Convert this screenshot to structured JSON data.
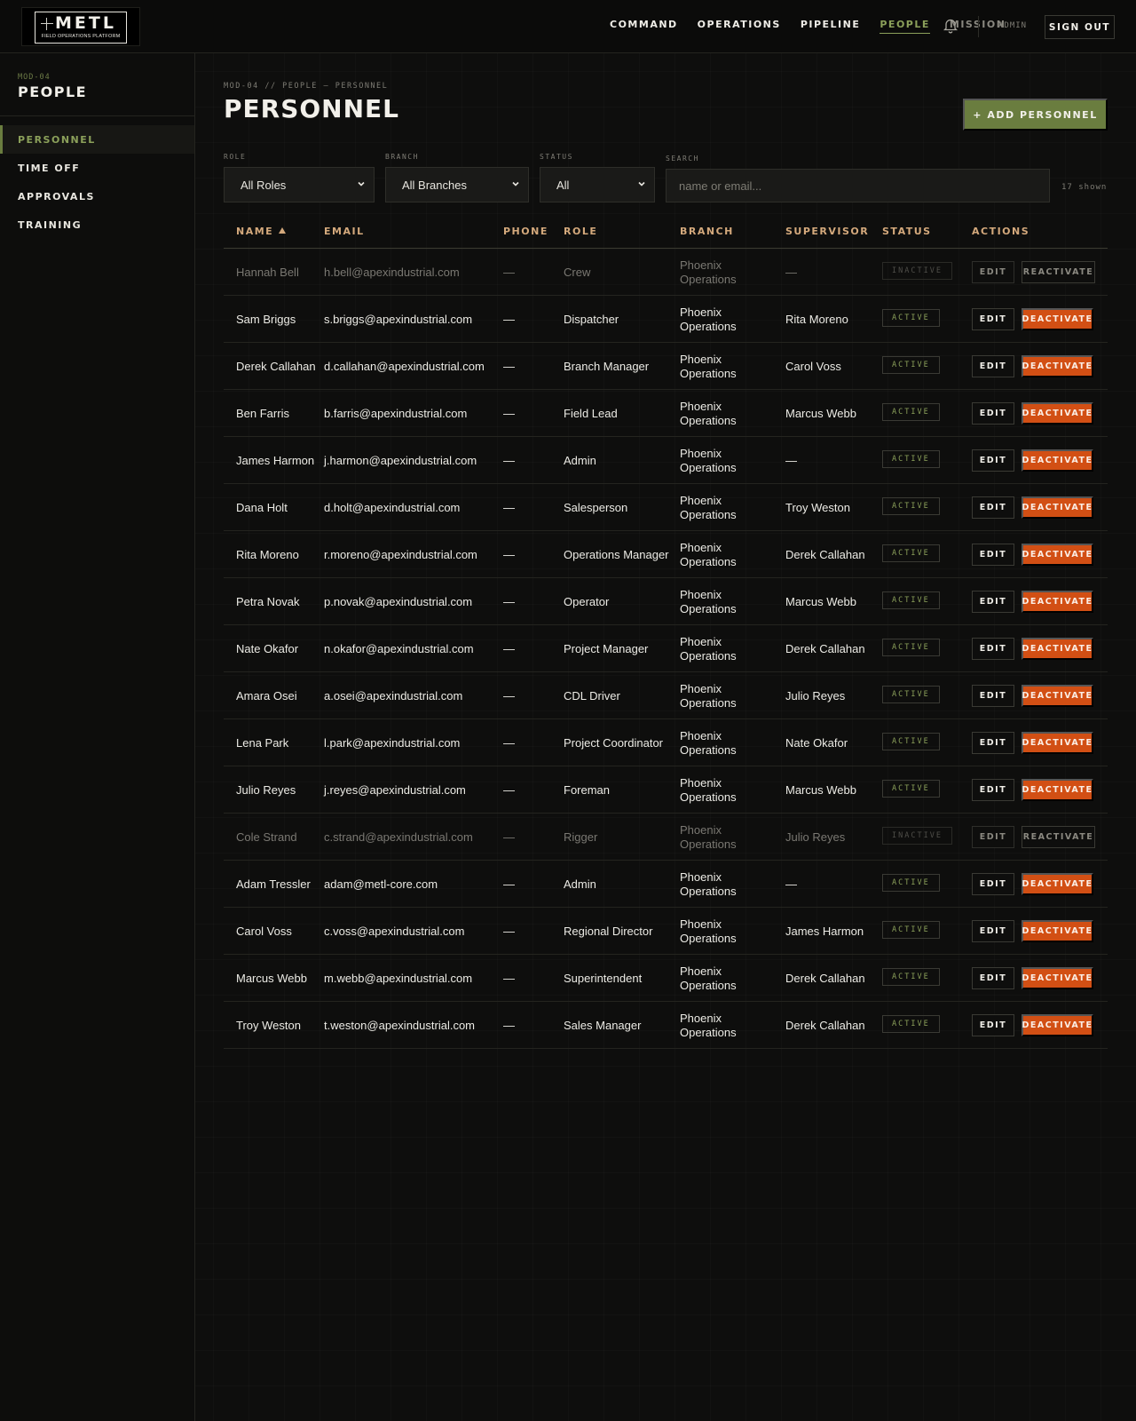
{
  "app": {
    "logo_text": "METL",
    "logo_subtitle": "FIELD OPERATIONS PLATFORM"
  },
  "nav": {
    "items": [
      {
        "label": "COMMAND",
        "state": "normal"
      },
      {
        "label": "OPERATIONS",
        "state": "normal"
      },
      {
        "label": "PIPELINE",
        "state": "normal"
      },
      {
        "label": "PEOPLE",
        "state": "active"
      },
      {
        "label": "MISSION",
        "state": "muted"
      }
    ],
    "bell_icon": "bell-icon",
    "user_label": "ADMIN",
    "sign_out_label": "SIGN OUT"
  },
  "sidebar": {
    "module_code": "MOD-04",
    "title": "PEOPLE",
    "items": [
      {
        "label": "PERSONNEL",
        "active": true
      },
      {
        "label": "TIME OFF",
        "active": false
      },
      {
        "label": "APPROVALS",
        "active": false
      },
      {
        "label": "TRAINING",
        "active": false
      }
    ]
  },
  "page": {
    "breadcrumb": "MOD-04 // PEOPLE — PERSONNEL",
    "title": "PERSONNEL",
    "add_button_label": "+ ADD PERSONNEL"
  },
  "filters": {
    "role": {
      "label": "ROLE",
      "value": "All Roles"
    },
    "branch": {
      "label": "BRANCH",
      "value": "All Branches"
    },
    "status": {
      "label": "STATUS",
      "value": "All"
    },
    "search": {
      "label": "SEARCH",
      "value": "",
      "placeholder": "name or email..."
    },
    "shown_count": "17 shown"
  },
  "table": {
    "columns": [
      "NAME",
      "EMAIL",
      "PHONE",
      "ROLE",
      "BRANCH",
      "SUPERVISOR",
      "STATUS",
      "ACTIONS"
    ],
    "sort_column": "NAME",
    "sort_direction": "asc",
    "rows": [
      {
        "name": "Hannah Bell",
        "email": "h.bell@apexindustrial.com",
        "phone": "—",
        "role": "Crew",
        "branch": "Phoenix Operations",
        "supervisor": "—",
        "status": "INACTIVE",
        "edit": "EDIT",
        "action": "REACTIVATE"
      },
      {
        "name": "Sam Briggs",
        "email": "s.briggs@apexindustrial.com",
        "phone": "—",
        "role": "Dispatcher",
        "branch": "Phoenix Operations",
        "supervisor": "Rita Moreno",
        "status": "ACTIVE",
        "edit": "EDIT",
        "action": "DEACTIVATE"
      },
      {
        "name": "Derek Callahan",
        "email": "d.callahan@apexindustrial.com",
        "phone": "—",
        "role": "Branch Manager",
        "branch": "Phoenix Operations",
        "supervisor": "Carol Voss",
        "status": "ACTIVE",
        "edit": "EDIT",
        "action": "DEACTIVATE"
      },
      {
        "name": "Ben Farris",
        "email": "b.farris@apexindustrial.com",
        "phone": "—",
        "role": "Field Lead",
        "branch": "Phoenix Operations",
        "supervisor": "Marcus Webb",
        "status": "ACTIVE",
        "edit": "EDIT",
        "action": "DEACTIVATE"
      },
      {
        "name": "James Harmon",
        "email": "j.harmon@apexindustrial.com",
        "phone": "—",
        "role": "Admin",
        "branch": "Phoenix Operations",
        "supervisor": "—",
        "status": "ACTIVE",
        "edit": "EDIT",
        "action": "DEACTIVATE"
      },
      {
        "name": "Dana Holt",
        "email": "d.holt@apexindustrial.com",
        "phone": "—",
        "role": "Salesperson",
        "branch": "Phoenix Operations",
        "supervisor": "Troy Weston",
        "status": "ACTIVE",
        "edit": "EDIT",
        "action": "DEACTIVATE"
      },
      {
        "name": "Rita Moreno",
        "email": "r.moreno@apexindustrial.com",
        "phone": "—",
        "role": "Operations Manager",
        "branch": "Phoenix Operations",
        "supervisor": "Derek Callahan",
        "status": "ACTIVE",
        "edit": "EDIT",
        "action": "DEACTIVATE"
      },
      {
        "name": "Petra Novak",
        "email": "p.novak@apexindustrial.com",
        "phone": "—",
        "role": "Operator",
        "branch": "Phoenix Operations",
        "supervisor": "Marcus Webb",
        "status": "ACTIVE",
        "edit": "EDIT",
        "action": "DEACTIVATE"
      },
      {
        "name": "Nate Okafor",
        "email": "n.okafor@apexindustrial.com",
        "phone": "—",
        "role": "Project Manager",
        "branch": "Phoenix Operations",
        "supervisor": "Derek Callahan",
        "status": "ACTIVE",
        "edit": "EDIT",
        "action": "DEACTIVATE"
      },
      {
        "name": "Amara Osei",
        "email": "a.osei@apexindustrial.com",
        "phone": "—",
        "role": "CDL Driver",
        "branch": "Phoenix Operations",
        "supervisor": "Julio Reyes",
        "status": "ACTIVE",
        "edit": "EDIT",
        "action": "DEACTIVATE"
      },
      {
        "name": "Lena Park",
        "email": "l.park@apexindustrial.com",
        "phone": "—",
        "role": "Project Coordinator",
        "branch": "Phoenix Operations",
        "supervisor": "Nate Okafor",
        "status": "ACTIVE",
        "edit": "EDIT",
        "action": "DEACTIVATE"
      },
      {
        "name": "Julio Reyes",
        "email": "j.reyes@apexindustrial.com",
        "phone": "—",
        "role": "Foreman",
        "branch": "Phoenix Operations",
        "supervisor": "Marcus Webb",
        "status": "ACTIVE",
        "edit": "EDIT",
        "action": "DEACTIVATE"
      },
      {
        "name": "Cole Strand",
        "email": "c.strand@apexindustrial.com",
        "phone": "—",
        "role": "Rigger",
        "branch": "Phoenix Operations",
        "supervisor": "Julio Reyes",
        "status": "INACTIVE",
        "edit": "EDIT",
        "action": "REACTIVATE"
      },
      {
        "name": "Adam Tressler",
        "email": "adam@metl-core.com",
        "phone": "—",
        "role": "Admin",
        "branch": "Phoenix Operations",
        "supervisor": "—",
        "status": "ACTIVE",
        "edit": "EDIT",
        "action": "DEACTIVATE"
      },
      {
        "name": "Carol Voss",
        "email": "c.voss@apexindustrial.com",
        "phone": "—",
        "role": "Regional Director",
        "branch": "Phoenix Operations",
        "supervisor": "James Harmon",
        "status": "ACTIVE",
        "edit": "EDIT",
        "action": "DEACTIVATE"
      },
      {
        "name": "Marcus Webb",
        "email": "m.webb@apexindustrial.com",
        "phone": "—",
        "role": "Superintendent",
        "branch": "Phoenix Operations",
        "supervisor": "Derek Callahan",
        "status": "ACTIVE",
        "edit": "EDIT",
        "action": "DEACTIVATE"
      },
      {
        "name": "Troy Weston",
        "email": "t.weston@apexindustrial.com",
        "phone": "—",
        "role": "Sales Manager",
        "branch": "Phoenix Operations",
        "supervisor": "Derek Callahan",
        "status": "ACTIVE",
        "edit": "EDIT",
        "action": "DEACTIVATE"
      }
    ]
  },
  "colors": {
    "accent_green": "#6a7d3f",
    "active_nav": "#8ba05a",
    "header_tan": "#d4a97c",
    "danger_orange": "#d24f14",
    "background": "#0e0e0d"
  }
}
